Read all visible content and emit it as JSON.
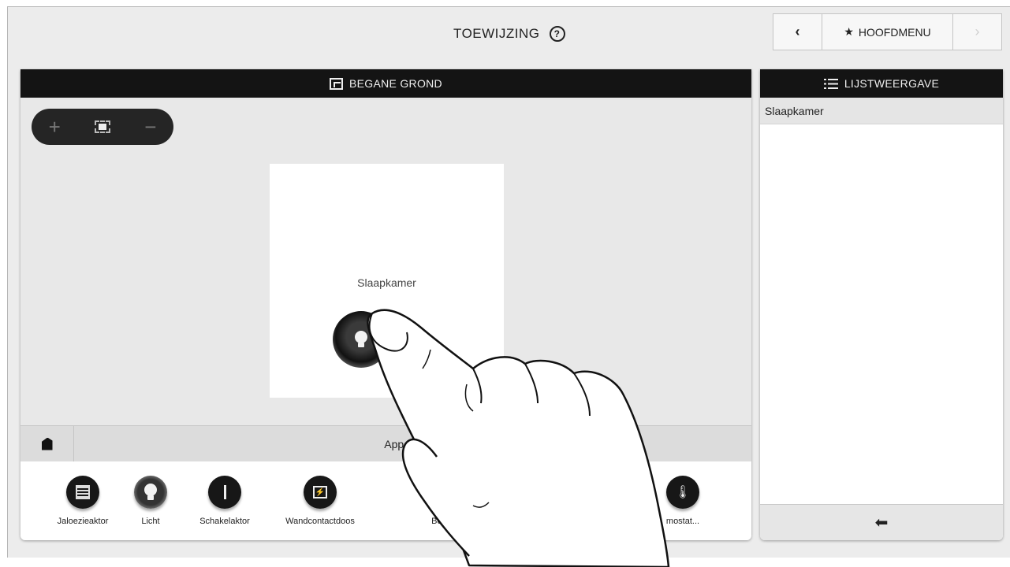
{
  "header": {
    "title": "TOEWIJZING",
    "help_glyph": "?"
  },
  "topnav": {
    "back_glyph": "‹",
    "home_label": "HOOFDMENU",
    "home_star": "★",
    "forward_glyph": "›"
  },
  "floor_panel": {
    "title": "BEGANE GROND",
    "zoom": {
      "in": "+",
      "out": "−"
    },
    "room": {
      "name": "Slaapkamer",
      "device_icon": "light-bulb-icon"
    }
  },
  "device_tray": {
    "title": "Apparaat to",
    "devices": [
      {
        "label": "Jaloezieaktor",
        "icon": "blind-icon"
      },
      {
        "label": "Licht",
        "icon": "light-bulb-icon",
        "active": true
      },
      {
        "label": "Schakelaktor",
        "icon": "switch-icon"
      },
      {
        "label": "Wandcontactdoos",
        "icon": "socket-icon"
      },
      {
        "label": "Bewege",
        "icon": "motion-icon"
      },
      {
        "label": "mostat...",
        "icon": "thermostat-icon"
      }
    ]
  },
  "list_panel": {
    "title": "LIJSTWEERGAVE",
    "items": [
      "Slaapkamer"
    ],
    "footer_glyph": "⬅"
  }
}
